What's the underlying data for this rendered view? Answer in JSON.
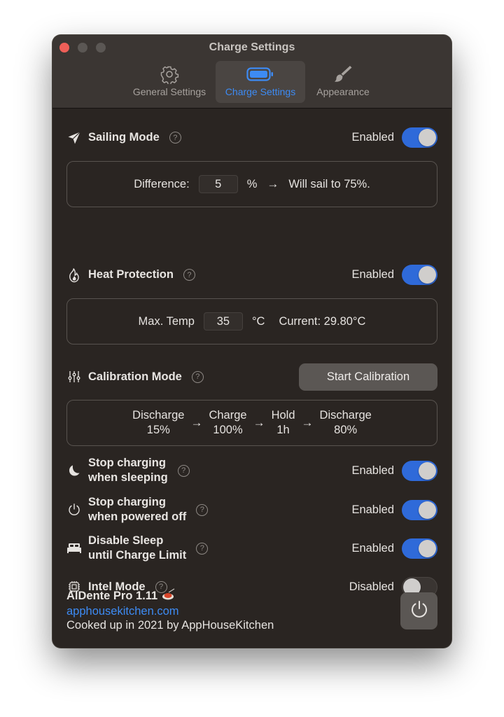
{
  "window": {
    "title": "Charge Settings",
    "controls": [
      "close",
      "minimize",
      "maximize"
    ]
  },
  "tabs": [
    {
      "label": "General Settings",
      "icon": "gear-icon",
      "active": false
    },
    {
      "label": "Charge Settings",
      "icon": "battery-icon",
      "active": true
    },
    {
      "label": "Appearance",
      "icon": "paintbrush-icon",
      "active": false
    }
  ],
  "sailing": {
    "label": "Sailing Mode",
    "icon": "paperplane-icon",
    "status": "Enabled",
    "enabled": true,
    "difference_label": "Difference:",
    "difference_value": "5",
    "unit": "%",
    "arrow": "→",
    "result": "Will sail to 75%."
  },
  "heat": {
    "label": "Heat Protection",
    "icon": "flame-icon",
    "status": "Enabled",
    "enabled": true,
    "max_label": "Max. Temp",
    "max_value": "35",
    "unit": "°C",
    "current": "Current: 29.80°C"
  },
  "calibration": {
    "label": "Calibration Mode",
    "icon": "sliders-icon",
    "button": "Start Calibration",
    "steps": [
      {
        "name": "Discharge",
        "value": "15%"
      },
      {
        "name": "Charge",
        "value": "100%"
      },
      {
        "name": "Hold",
        "value": "1h"
      },
      {
        "name": "Discharge",
        "value": "80%"
      }
    ],
    "arrow": "→"
  },
  "options": [
    {
      "line1": "Stop charging",
      "line2": "when sleeping",
      "icon": "moon-icon",
      "status": "Enabled",
      "enabled": true
    },
    {
      "line1": "Stop charging",
      "line2": "when powered off",
      "icon": "power-icon",
      "status": "Enabled",
      "enabled": true
    },
    {
      "line1": "Disable Sleep",
      "line2": "until Charge Limit",
      "icon": "bed-icon",
      "status": "Enabled",
      "enabled": true
    },
    {
      "line1": "Intel Mode",
      "line2": "",
      "icon": "cpu-icon",
      "status": "Disabled",
      "enabled": false
    }
  ],
  "help_glyph": "?",
  "footer": {
    "app_name": "AlDente Pro 1.11",
    "link": "apphousekitchen.com",
    "credit": "Cooked up in 2021 by AppHouseKitchen",
    "quit_icon": "power-icon"
  },
  "colors": {
    "accent": "#3d8bf4",
    "toggle_on": "#2f6ad9",
    "background": "#2a2522",
    "close": "#ee5f58"
  }
}
